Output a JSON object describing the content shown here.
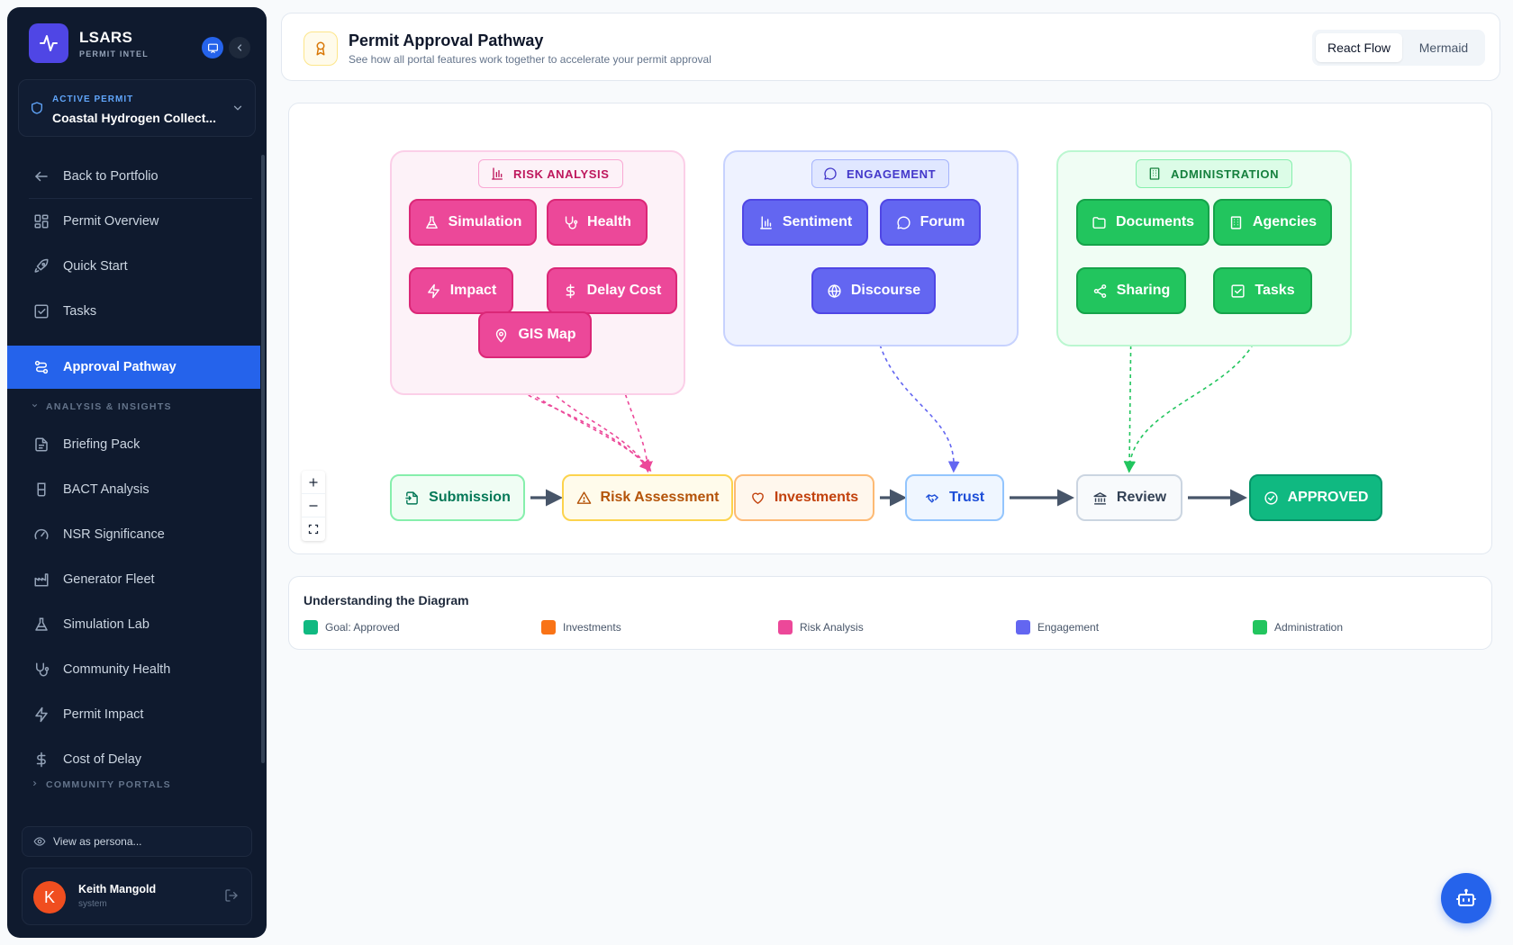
{
  "brand": {
    "name": "LSARS",
    "subtitle": "PERMIT INTEL"
  },
  "active_permit": {
    "label": "ACTIVE PERMIT",
    "name": "Coastal Hydrogen Collect..."
  },
  "nav": {
    "back": "Back to Portfolio",
    "items": [
      {
        "label": "Permit Overview",
        "icon": "grid-icon"
      },
      {
        "label": "Quick Start",
        "icon": "rocket-icon"
      },
      {
        "label": "Tasks",
        "icon": "checkbox-icon"
      },
      {
        "label": "Approval Pathway",
        "icon": "route-icon",
        "active": true
      }
    ],
    "section_analysis": "ANALYSIS & INSIGHTS",
    "analysis_items": [
      {
        "label": "Briefing Pack",
        "icon": "document-icon"
      },
      {
        "label": "BACT Analysis",
        "icon": "beaker-icon"
      },
      {
        "label": "NSR Significance",
        "icon": "gauge-icon"
      },
      {
        "label": "Generator Fleet",
        "icon": "factory-icon"
      },
      {
        "label": "Simulation Lab",
        "icon": "flask-icon"
      },
      {
        "label": "Community Health",
        "icon": "stethoscope-icon"
      },
      {
        "label": "Permit Impact",
        "icon": "bolt-icon"
      },
      {
        "label": "Cost of Delay",
        "icon": "dollar-icon"
      }
    ],
    "section_community": "COMMUNITY PORTALS"
  },
  "persona_button": "View as persona...",
  "user": {
    "name": "Keith Mangold",
    "role": "system",
    "initial": "K"
  },
  "header": {
    "title": "Permit Approval Pathway",
    "subtitle": "See how all portal features work together to accelerate your permit approval",
    "view_options": [
      "React Flow",
      "Mermaid"
    ],
    "active_view": "React Flow"
  },
  "diagram": {
    "groups": {
      "risk": {
        "label": "RISK ANALYSIS",
        "nodes": [
          "Simulation",
          "Health",
          "Impact",
          "Delay Cost",
          "GIS Map"
        ]
      },
      "engagement": {
        "label": "ENGAGEMENT",
        "nodes": [
          "Sentiment",
          "Forum",
          "Discourse"
        ]
      },
      "admin": {
        "label": "ADMINISTRATION",
        "nodes": [
          "Documents",
          "Agencies",
          "Sharing",
          "Tasks"
        ]
      }
    },
    "pathway": [
      "Submission",
      "Risk Assessment",
      "Investments",
      "Trust",
      "Review",
      "APPROVED"
    ]
  },
  "legend": {
    "title": "Understanding the Diagram",
    "items": [
      {
        "label": "Goal: Approved",
        "color": "#10b981"
      },
      {
        "label": "Investments",
        "color": "#f97316"
      },
      {
        "label": "Risk Analysis",
        "color": "#ec4899"
      },
      {
        "label": "Engagement",
        "color": "#6366f1"
      },
      {
        "label": "Administration",
        "color": "#22c55e"
      }
    ]
  },
  "colors": {
    "accent": "#2563eb",
    "sidebar": "#0f1a2e",
    "risk": "#ec4899",
    "engagement": "#6366f1",
    "admin": "#22c55e",
    "goal": "#10b981",
    "investments": "#f97316"
  }
}
